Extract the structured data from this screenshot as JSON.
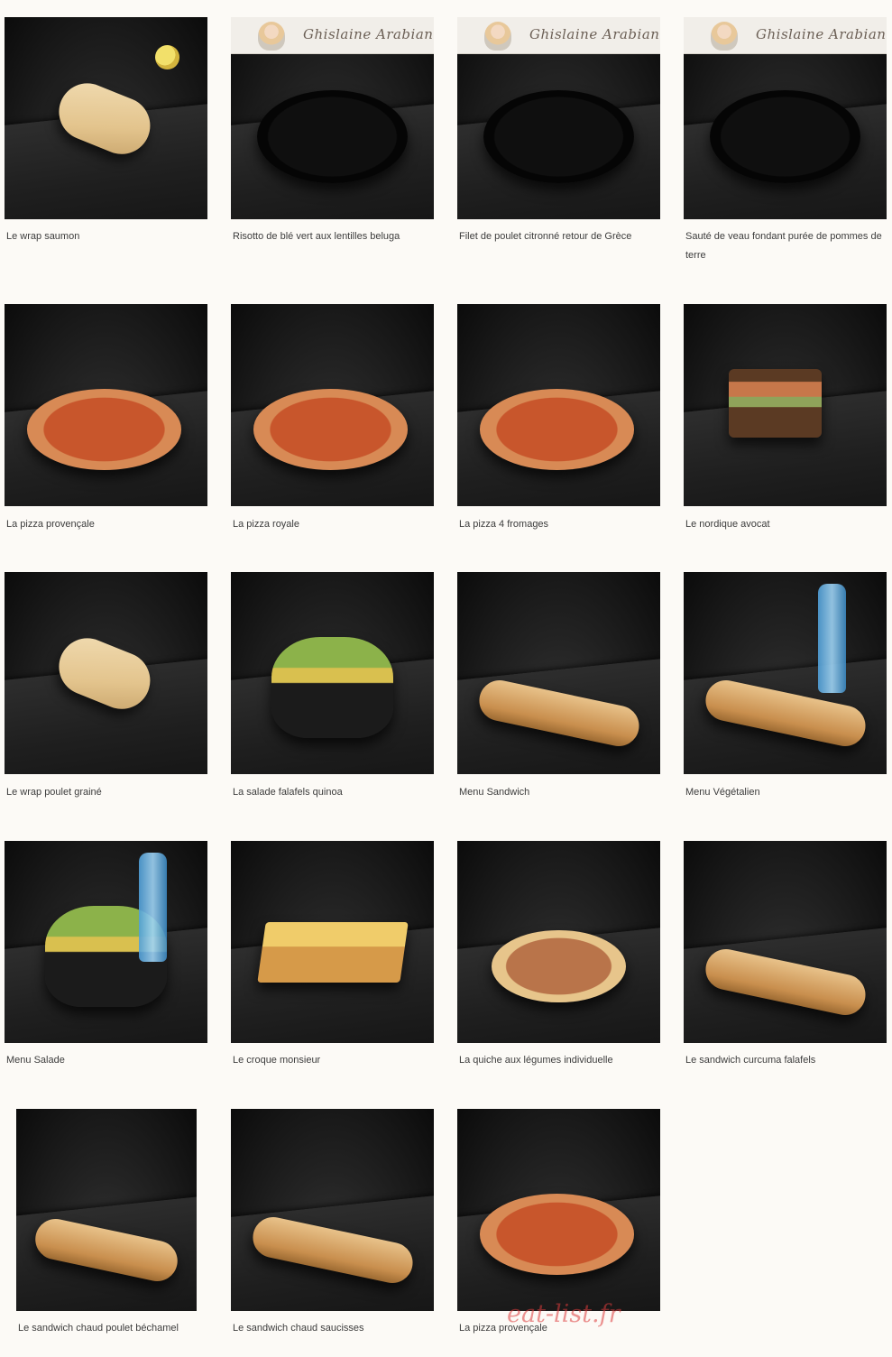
{
  "products": [
    {
      "name": "Le wrap saumon",
      "chef_banner": false,
      "visual": "wrap",
      "accent": "lemon"
    },
    {
      "name": "Risotto de blé vert aux lentilles beluga",
      "chef_banner": true,
      "visual": "plate"
    },
    {
      "name": "Filet de poulet citronné retour de Grèce",
      "chef_banner": true,
      "visual": "plate"
    },
    {
      "name": "Sauté de veau fondant purée de pommes de terre",
      "chef_banner": true,
      "visual": "plate"
    },
    {
      "name": "La pizza provençale",
      "chef_banner": false,
      "visual": "pizza"
    },
    {
      "name": "La pizza royale",
      "chef_banner": false,
      "visual": "pizza"
    },
    {
      "name": "La pizza 4 fromages",
      "chef_banner": false,
      "visual": "pizza"
    },
    {
      "name": "Le nordique avocat",
      "chef_banner": false,
      "visual": "sandwich"
    },
    {
      "name": "Le wrap poulet grainé",
      "chef_banner": false,
      "visual": "wrap"
    },
    {
      "name": "La salade falafels quinoa",
      "chef_banner": false,
      "visual": "bowl"
    },
    {
      "name": "Menu Sandwich",
      "chef_banner": false,
      "visual": "baguette"
    },
    {
      "name": "Menu Végétalien",
      "chef_banner": false,
      "visual": "baguette",
      "accent": "bottle"
    },
    {
      "name": "Menu Salade",
      "chef_banner": false,
      "visual": "bowl",
      "accent": "bottle"
    },
    {
      "name": "Le croque monsieur",
      "chef_banner": false,
      "visual": "croque"
    },
    {
      "name": "La quiche aux légumes individuelle",
      "chef_banner": false,
      "visual": "quiche"
    },
    {
      "name": "Le sandwich curcuma falafels",
      "chef_banner": false,
      "visual": "baguette"
    },
    {
      "name": "Le sandwich chaud poulet béchamel",
      "chef_banner": false,
      "visual": "baguette"
    },
    {
      "name": "Le sandwich chaud saucisses",
      "chef_banner": false,
      "visual": "baguette"
    },
    {
      "name": "La pizza provençale",
      "chef_banner": false,
      "visual": "pizza"
    }
  ],
  "chef_signature": "Ghislaine Arabian",
  "watermark": "eat-list.fr"
}
